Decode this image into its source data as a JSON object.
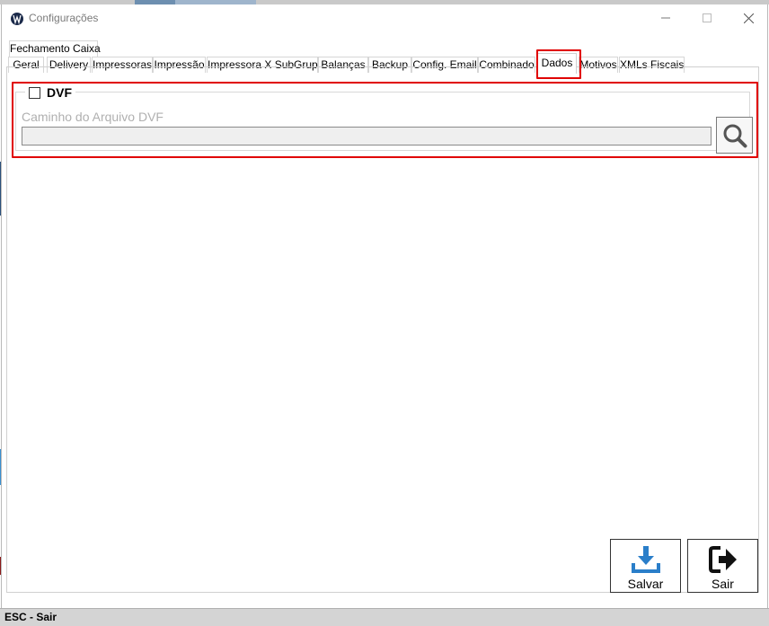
{
  "window": {
    "title": "Configurações",
    "controls": {
      "minimize": "—",
      "maximize": "☐",
      "close": "✕"
    }
  },
  "tabs": {
    "row2": [
      {
        "label": "Fechamento Caixa"
      }
    ],
    "row1": [
      {
        "label": "Geral"
      },
      {
        "label": "Delivery"
      },
      {
        "label": "Impressoras"
      },
      {
        "label": "Impressão"
      },
      {
        "label": "Impressora X SubGrupo"
      },
      {
        "label": "Balanças"
      },
      {
        "label": "Backup"
      },
      {
        "label": "Config. Email"
      },
      {
        "label": "Combinado"
      },
      {
        "label": "Dados",
        "active": true
      },
      {
        "label": "Motivos"
      },
      {
        "label": "XMLs Fiscais"
      }
    ]
  },
  "dvf": {
    "checkbox_label": "DVF",
    "checked": false,
    "path_label": "Caminho do Arquivo DVF",
    "path_value": ""
  },
  "buttons": {
    "save_label": "Salvar",
    "exit_label": "Sair"
  },
  "status_bar": {
    "text": "ESC - Sair"
  },
  "colors": {
    "highlight": "#e00000",
    "save_icon": "#2a7ec9"
  }
}
